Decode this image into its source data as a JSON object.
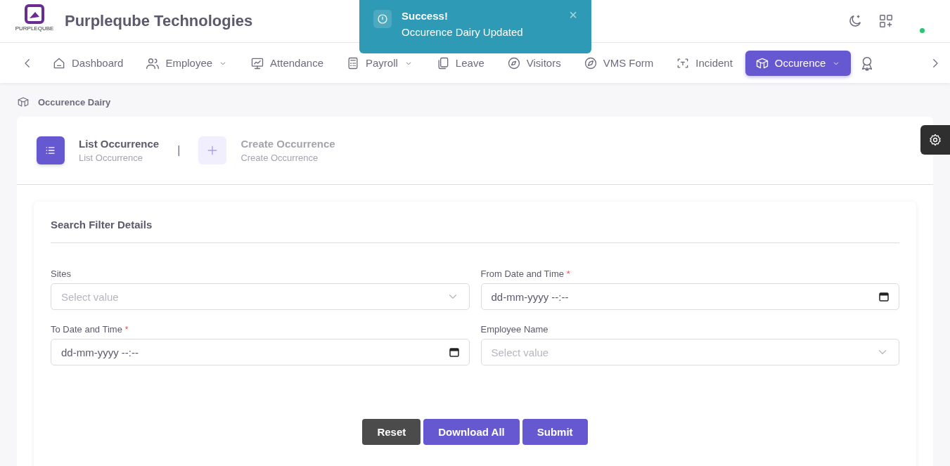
{
  "header": {
    "logo_text": "PURPLEQUBE",
    "title": "Purpleqube Technologies",
    "status_online": true
  },
  "toast": {
    "title": "Success!",
    "message": "Occurence Dairy Updated",
    "close": "×"
  },
  "nav": [
    {
      "label": "Dashboard",
      "dropdown": false,
      "selected": false
    },
    {
      "label": "Employee",
      "dropdown": true,
      "selected": false
    },
    {
      "label": "Attendance",
      "dropdown": false,
      "selected": false
    },
    {
      "label": "Payroll",
      "dropdown": true,
      "selected": false
    },
    {
      "label": "Leave",
      "dropdown": false,
      "selected": false
    },
    {
      "label": "Visitors",
      "dropdown": false,
      "selected": false
    },
    {
      "label": "VMS Form",
      "dropdown": false,
      "selected": false
    },
    {
      "label": "Incident",
      "dropdown": false,
      "selected": false
    },
    {
      "label": "Occurence",
      "dropdown": true,
      "selected": true
    }
  ],
  "breadcrumb": "Occurence Dairy",
  "steps": [
    {
      "title": "List Occurrence",
      "subtitle": "List Occurrence",
      "selected": true
    },
    {
      "title": "Create Occurrence",
      "subtitle": "Create Occurrence",
      "selected": false
    }
  ],
  "step_separator": "|",
  "filter": {
    "title": "Search Filter Details",
    "fields": [
      {
        "label": "Sites",
        "kind": "select",
        "placeholder": "Select value"
      },
      {
        "label": "From Date and Time",
        "required_mark": "*",
        "kind": "datetime",
        "placeholder": "dd-mm-yyyy --:--"
      },
      {
        "label": "To Date and Time",
        "required_mark": "*",
        "kind": "datetime",
        "placeholder": "dd-mm-yyyy --:--"
      },
      {
        "label": "Employee Name",
        "kind": "select",
        "placeholder": "Select value"
      }
    ],
    "buttons": [
      {
        "label": "Reset",
        "kind": "secondary"
      },
      {
        "label": "Download All",
        "kind": "primary"
      },
      {
        "label": "Submit",
        "kind": "primary"
      }
    ]
  }
}
